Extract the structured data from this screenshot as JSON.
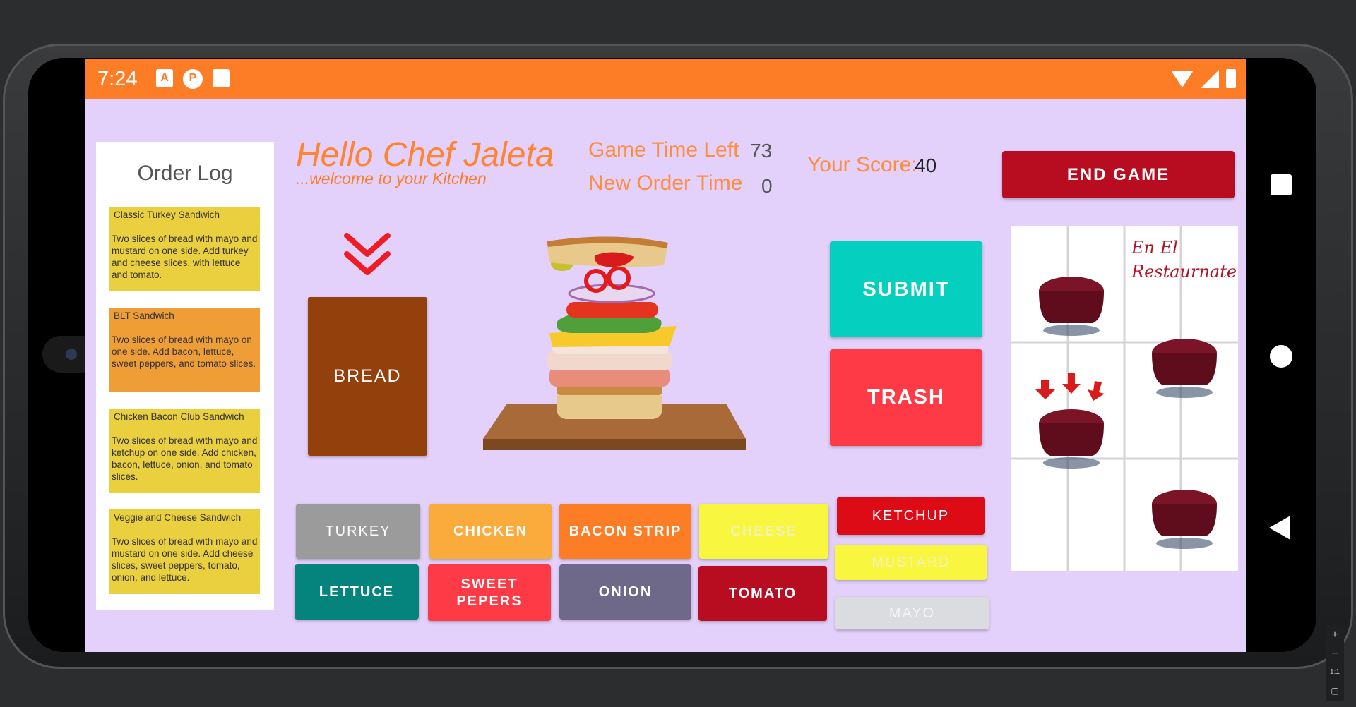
{
  "statusbar": {
    "time": "7:24",
    "icons": [
      "a-icon",
      "p-icon",
      "sd-card-icon"
    ],
    "right_icons": [
      "wifi-icon",
      "signal-icon",
      "battery-icon"
    ]
  },
  "order_log": {
    "title": "Order Log",
    "orders": [
      {
        "name": "Classic Turkey Sandwich",
        "description": "Two slices of bread with mayo and mustard on one side. Add turkey and cheese slices, with lettuce and tomato.",
        "color": "#eacf3e"
      },
      {
        "name": "BLT Sandwich",
        "description": "Two slices of bread with mayo on one side. Add bacon, lettuce, sweet peppers, and tomato slices.",
        "color": "#ef9d37"
      },
      {
        "name": "Chicken Bacon Club Sandwich",
        "description": "Two slices of bread with mayo and ketchup on one side. Add chicken, bacon, lettuce, onion, and tomato slices.",
        "color": "#eacf3e"
      },
      {
        "name": "Veggie and Cheese Sandwich",
        "description": "Two slices of bread with mayo and mustard on one side. Add cheese slices, sweet peppers, tomato, onion, and lettuce.",
        "color": "#eacf3e"
      }
    ]
  },
  "header": {
    "greeting": "Hello Chef Jaleta",
    "welcome": "...welcome to your Kitchen"
  },
  "stats": {
    "game_time_label": "Game Time Left",
    "game_time_value": "73",
    "new_order_label": "New Order Time",
    "new_order_value": "0",
    "score_label": "Your Score:",
    "score_value": "40"
  },
  "buttons": {
    "end_game": "END GAME",
    "submit": "SUBMIT",
    "trash": "TRASH",
    "bread": "BREAD"
  },
  "ingredients": {
    "turkey": "TURKEY",
    "chicken": "CHICKEN",
    "bacon": "BACON STRIP",
    "cheese": "CHEESE",
    "lettuce": "LETTUCE",
    "sweet_peppers": "SWEET PEPERS",
    "onion": "ONION",
    "tomato": "TOMATO",
    "ketchup": "KETCHUP",
    "mustard": "MUSTARD",
    "mayo": "MAYO"
  },
  "restaurant": {
    "title_line1": "En El",
    "title_line2": "Restaurnate"
  },
  "colors": {
    "accent": "#fd7d27",
    "background": "#e3d1fb",
    "end_game": "#b80c20",
    "submit": "#05cfbf",
    "trash": "#fd3a45"
  }
}
